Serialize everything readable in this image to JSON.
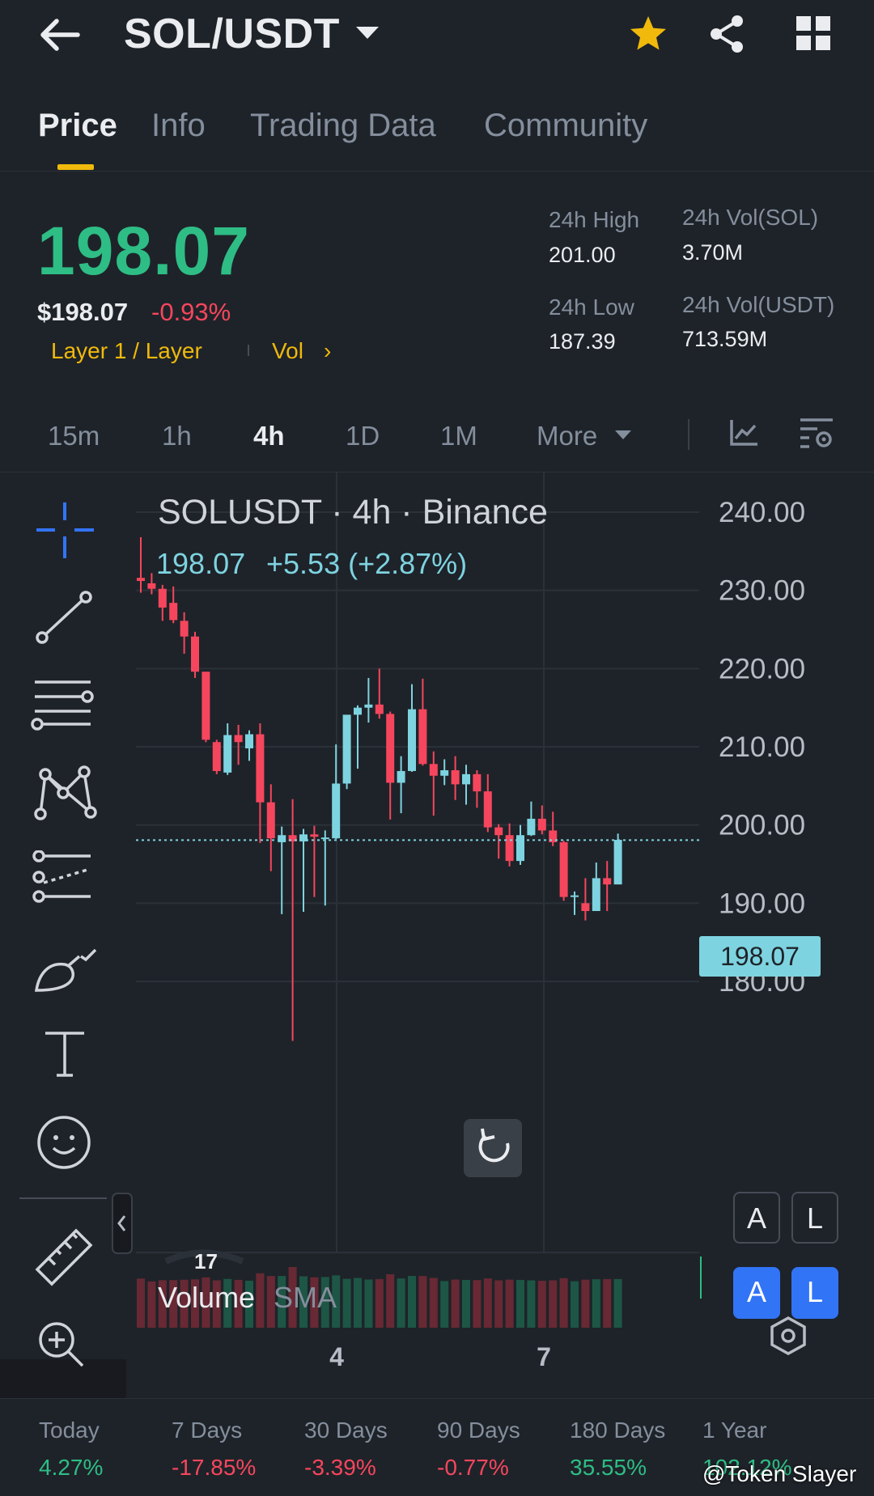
{
  "header": {
    "title": "SOL/USDT"
  },
  "tabs": [
    "Price",
    "Info",
    "Trading Data",
    "Community"
  ],
  "price": {
    "last": "198.07",
    "usd": "$198.07",
    "change": "-0.93%",
    "tags": "Layer 1 / Layer",
    "vol_tag": "Vol",
    "vol_arrow": "›"
  },
  "stats": {
    "high_label": "24h High",
    "high": "201.00",
    "low_label": "24h Low",
    "low": "187.39",
    "vol_sol_label": "24h Vol(SOL)",
    "vol_sol": "3.70M",
    "vol_usdt_label": "24h Vol(USDT)",
    "vol_usdt": "713.59M"
  },
  "timeframes": [
    "15m",
    "1h",
    "4h",
    "1D",
    "1M",
    "More"
  ],
  "chart": {
    "legend_symbol": "SOLUSDT · 4h · Binance",
    "legend_price": "198.07",
    "legend_change": "+5.53 (+2.87%)",
    "current_price": "198.07",
    "volume_label": "Volume",
    "sma_label": "SMA",
    "badge_a": "A",
    "badge_l": "L",
    "x_labels": [
      "4",
      "7"
    ]
  },
  "chart_data": {
    "type": "candlestick",
    "title": "SOLUSDT · 4h · Binance",
    "ylim": [
      177.5,
      242.5
    ],
    "y_ticks": [
      "240.00",
      "230.00",
      "220.00",
      "210.00",
      "200.00",
      "190.00",
      "180.00"
    ],
    "x_tick_labels": [
      "4",
      "7"
    ],
    "last_price": 198.07,
    "candles": [
      {
        "o": 231.6,
        "h": 236.8,
        "l": 229.7,
        "c": 231.2
      },
      {
        "o": 230.9,
        "h": 232.2,
        "l": 229.5,
        "c": 230.2
      },
      {
        "o": 230.2,
        "h": 230.7,
        "l": 226.1,
        "c": 227.8
      },
      {
        "o": 228.4,
        "h": 230.5,
        "l": 225.8,
        "c": 226.2
      },
      {
        "o": 226.1,
        "h": 227.2,
        "l": 221.9,
        "c": 224.1
      },
      {
        "o": 224.1,
        "h": 224.7,
        "l": 218.8,
        "c": 219.6
      },
      {
        "o": 219.6,
        "h": 219.6,
        "l": 210.6,
        "c": 210.9
      },
      {
        "o": 210.6,
        "h": 210.9,
        "l": 206.5,
        "c": 206.9
      },
      {
        "o": 206.7,
        "h": 213.0,
        "l": 206.4,
        "c": 211.5
      },
      {
        "o": 211.5,
        "h": 212.8,
        "l": 207.7,
        "c": 210.6
      },
      {
        "o": 209.8,
        "h": 212.1,
        "l": 208.2,
        "c": 211.6
      },
      {
        "o": 211.6,
        "h": 213.0,
        "l": 197.7,
        "c": 202.9
      },
      {
        "o": 202.9,
        "h": 205.2,
        "l": 194.1,
        "c": 198.3
      },
      {
        "o": 197.8,
        "h": 199.8,
        "l": 188.6,
        "c": 198.7
      },
      {
        "o": 198.7,
        "h": 203.3,
        "l": 172.4,
        "c": 197.9
      },
      {
        "o": 197.9,
        "h": 199.5,
        "l": 188.9,
        "c": 198.8
      },
      {
        "o": 198.8,
        "h": 199.9,
        "l": 190.8,
        "c": 198.5
      },
      {
        "o": 198.2,
        "h": 199.3,
        "l": 189.7,
        "c": 198.4
      },
      {
        "o": 198.3,
        "h": 210.3,
        "l": 198.2,
        "c": 205.3
      },
      {
        "o": 205.3,
        "h": 211.4,
        "l": 204.6,
        "c": 214.1
      },
      {
        "o": 214.1,
        "h": 215.3,
        "l": 207.2,
        "c": 215.0
      },
      {
        "o": 215.0,
        "h": 218.8,
        "l": 213.1,
        "c": 215.4
      },
      {
        "o": 215.4,
        "h": 220.0,
        "l": 213.6,
        "c": 214.2
      },
      {
        "o": 214.2,
        "h": 214.5,
        "l": 200.7,
        "c": 205.4
      },
      {
        "o": 205.4,
        "h": 208.8,
        "l": 201.5,
        "c": 206.9
      },
      {
        "o": 206.9,
        "h": 218.0,
        "l": 206.8,
        "c": 214.8
      },
      {
        "o": 214.8,
        "h": 218.7,
        "l": 207.6,
        "c": 207.8
      },
      {
        "o": 207.8,
        "h": 209.4,
        "l": 201.2,
        "c": 206.3
      },
      {
        "o": 206.3,
        "h": 208.4,
        "l": 205.1,
        "c": 207.0
      },
      {
        "o": 207.0,
        "h": 208.8,
        "l": 203.2,
        "c": 205.2
      },
      {
        "o": 205.2,
        "h": 207.7,
        "l": 202.6,
        "c": 206.5
      },
      {
        "o": 206.5,
        "h": 207.0,
        "l": 202.2,
        "c": 204.3
      },
      {
        "o": 204.3,
        "h": 206.5,
        "l": 199.1,
        "c": 199.7
      },
      {
        "o": 199.7,
        "h": 200.1,
        "l": 195.7,
        "c": 198.7
      },
      {
        "o": 198.7,
        "h": 200.2,
        "l": 194.7,
        "c": 195.4
      },
      {
        "o": 195.4,
        "h": 200.0,
        "l": 194.9,
        "c": 198.7
      },
      {
        "o": 198.7,
        "h": 203.0,
        "l": 198.6,
        "c": 200.8
      },
      {
        "o": 200.8,
        "h": 202.5,
        "l": 198.8,
        "c": 199.3
      },
      {
        "o": 199.3,
        "h": 201.7,
        "l": 197.3,
        "c": 197.8
      },
      {
        "o": 197.8,
        "h": 198.0,
        "l": 190.3,
        "c": 190.8
      },
      {
        "o": 190.8,
        "h": 191.5,
        "l": 188.5,
        "c": 191.0
      },
      {
        "o": 190.0,
        "h": 193.2,
        "l": 187.8,
        "c": 189.0
      },
      {
        "o": 189.0,
        "h": 195.2,
        "l": 189.1,
        "c": 193.2
      },
      {
        "o": 193.2,
        "h": 195.4,
        "l": 189.0,
        "c": 192.4
      },
      {
        "o": 192.4,
        "h": 198.9,
        "l": 192.5,
        "c": 198.1
      }
    ]
  },
  "periods": [
    {
      "label": "Today",
      "value": "4.27%",
      "dir": "up"
    },
    {
      "label": "7 Days",
      "value": "-17.85%",
      "dir": "down"
    },
    {
      "label": "30 Days",
      "value": "-3.39%",
      "dir": "down"
    },
    {
      "label": "90 Days",
      "value": "-0.77%",
      "dir": "down"
    },
    {
      "label": "180 Days",
      "value": "35.55%",
      "dir": "up"
    },
    {
      "label": "1 Year",
      "value": "102.12%",
      "dir": "up"
    }
  ],
  "watermark": "@Token Slayer",
  "colors": {
    "up": "#2ebd85",
    "down": "#f6465d",
    "candle_up": "#7ed3e0",
    "candle_down": "#f6465d",
    "accent": "#f0b90b",
    "blue": "#3274f6"
  }
}
